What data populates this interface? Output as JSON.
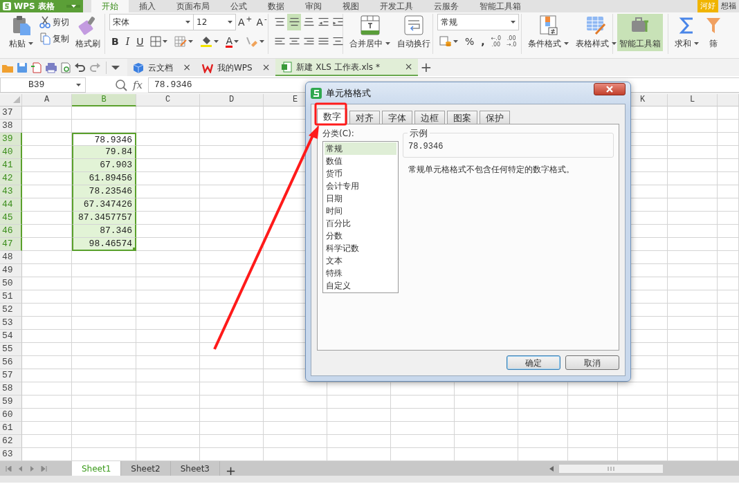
{
  "app_button": {
    "label": "WPS 表格"
  },
  "menu_tabs": [
    {
      "label": "开始",
      "selected": true
    },
    {
      "label": "插入",
      "selected": false
    },
    {
      "label": "页面布局",
      "selected": false
    },
    {
      "label": "公式",
      "selected": false
    },
    {
      "label": "数据",
      "selected": false
    },
    {
      "label": "审阅",
      "selected": false
    },
    {
      "label": "视图",
      "selected": false
    },
    {
      "label": "开发工具",
      "selected": false
    },
    {
      "label": "云服务",
      "selected": false
    },
    {
      "label": "智能工具箱",
      "selected": false
    }
  ],
  "user": {
    "badge": "河好",
    "name": "想福"
  },
  "ribbon": {
    "paste": "粘贴",
    "cut": "剪切",
    "copy": "复制",
    "format_painter": "格式刷",
    "font_name": "宋体",
    "font_size": "12",
    "grow_font": "A$^{+}$",
    "shrink_font": "A$^{-}$",
    "bold": "B",
    "italic": "I",
    "underline": "U",
    "font_color": "A",
    "align_buttons": [
      {
        "kind": "top",
        "selected": false
      },
      {
        "kind": "middle",
        "selected": true
      },
      {
        "kind": "bottom",
        "selected": false
      },
      {
        "kind": "outdent",
        "selected": false
      },
      {
        "kind": "indent",
        "selected": false
      },
      {
        "kind": "left",
        "selected": false
      },
      {
        "kind": "center",
        "selected": false
      },
      {
        "kind": "right",
        "selected": false
      },
      {
        "kind": "justify",
        "selected": false
      },
      {
        "kind": "distributed",
        "selected": false
      }
    ],
    "merge_center": "合并居中",
    "wrap_text": "自动换行",
    "number_format": "常规",
    "percent": "%",
    "comma": ",",
    "decimal_buttons": [
      {
        "top": "←.0",
        "bottom": ".00"
      },
      {
        "top": ".00",
        "bottom": "→.0"
      }
    ],
    "conditional_format": "条件格式",
    "table_style": "表格样式",
    "smart_toolbox": {
      "label": "智能工具箱",
      "selected": true
    },
    "sum": "求和",
    "filter": "筛"
  },
  "doc_tabs": [
    {
      "label": "云文档",
      "kind": "cloud",
      "selected": false,
      "close": "×"
    },
    {
      "label": "我的WPS",
      "kind": "home",
      "selected": false,
      "close": "×"
    },
    {
      "label": "新建 XLS 工作表.xls *",
      "kind": "sheet",
      "selected": true,
      "close": "×"
    }
  ],
  "new_tab": "+",
  "formula_bar": {
    "cell": "B39",
    "fx": "fx",
    "value": "78.9346"
  },
  "sheet": {
    "columns": [
      {
        "label": "A",
        "selected": false
      },
      {
        "label": "B",
        "selected": true
      },
      {
        "label": "C",
        "selected": false
      },
      {
        "label": "D",
        "selected": false
      },
      {
        "label": "E",
        "selected": false
      },
      {
        "label": "K",
        "selected": false
      },
      {
        "label": "L",
        "selected": false
      }
    ],
    "rows": [
      {
        "number": "37",
        "selected": false,
        "active": false
      },
      {
        "number": "38",
        "selected": false,
        "active": false
      },
      {
        "number": "39",
        "selected": true,
        "active": true,
        "b": "78.9346"
      },
      {
        "number": "40",
        "selected": true,
        "active": false,
        "b": "79.84"
      },
      {
        "number": "41",
        "selected": true,
        "active": false,
        "b": "67.903"
      },
      {
        "number": "42",
        "selected": true,
        "active": false,
        "b": "61.89456"
      },
      {
        "number": "43",
        "selected": true,
        "active": false,
        "b": "78.23546"
      },
      {
        "number": "44",
        "selected": true,
        "active": false,
        "b": "67.347426"
      },
      {
        "number": "45",
        "selected": true,
        "active": false,
        "b": "87.3457757"
      },
      {
        "number": "46",
        "selected": true,
        "active": false,
        "b": "87.346"
      },
      {
        "number": "47",
        "selected": true,
        "active": false,
        "b": "98.46574"
      },
      {
        "number": "48",
        "selected": false,
        "active": false
      },
      {
        "number": "49",
        "selected": false,
        "active": false
      },
      {
        "number": "50",
        "selected": false,
        "active": false
      },
      {
        "number": "51",
        "selected": false,
        "active": false
      },
      {
        "number": "52",
        "selected": false,
        "active": false
      },
      {
        "number": "53",
        "selected": false,
        "active": false
      },
      {
        "number": "54",
        "selected": false,
        "active": false
      },
      {
        "number": "55",
        "selected": false,
        "active": false
      },
      {
        "number": "56",
        "selected": false,
        "active": false
      },
      {
        "number": "57",
        "selected": false,
        "active": false
      },
      {
        "number": "58",
        "selected": false,
        "active": false
      },
      {
        "number": "59",
        "selected": false,
        "active": false
      },
      {
        "number": "60",
        "selected": false,
        "active": false
      },
      {
        "number": "61",
        "selected": false,
        "active": false
      },
      {
        "number": "62",
        "selected": false,
        "active": false
      },
      {
        "number": "63",
        "selected": false,
        "active": false
      }
    ]
  },
  "dialog": {
    "title": "单元格格式",
    "tabs": [
      {
        "label": "数字",
        "selected": true
      },
      {
        "label": "对齐",
        "selected": false
      },
      {
        "label": "字体",
        "selected": false
      },
      {
        "label": "边框",
        "selected": false
      },
      {
        "label": "图案",
        "selected": false
      },
      {
        "label": "保护",
        "selected": false
      }
    ],
    "category_label": "分类(C):",
    "categories": [
      {
        "label": "常规",
        "selected": true
      },
      {
        "label": "数值",
        "selected": false
      },
      {
        "label": "货币",
        "selected": false
      },
      {
        "label": "会计专用",
        "selected": false
      },
      {
        "label": "日期",
        "selected": false
      },
      {
        "label": "时间",
        "selected": false
      },
      {
        "label": "百分比",
        "selected": false
      },
      {
        "label": "分数",
        "selected": false
      },
      {
        "label": "科学记数",
        "selected": false
      },
      {
        "label": "文本",
        "selected": false
      },
      {
        "label": "特殊",
        "selected": false
      },
      {
        "label": "自定义",
        "selected": false
      }
    ],
    "sample_label": "示例",
    "sample_value": "78.9346",
    "description": "常规单元格格式不包含任何特定的数字格式。",
    "buttons": [
      {
        "label": "确定",
        "kind": "default"
      },
      {
        "label": "取消",
        "kind": "normal"
      }
    ]
  },
  "sheet_tabs": [
    {
      "label": "Sheet1",
      "selected": true
    },
    {
      "label": "Sheet2",
      "selected": false
    },
    {
      "label": "Sheet3",
      "selected": false
    }
  ],
  "add_sheet": "+"
}
